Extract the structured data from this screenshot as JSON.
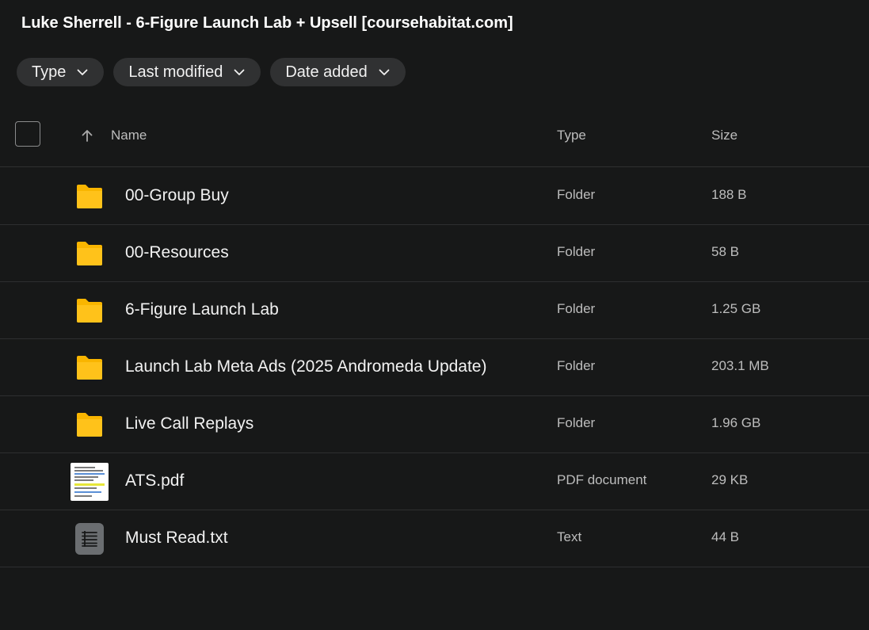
{
  "header": {
    "title": "Luke Sherrell - 6-Figure Launch Lab + Upsell [coursehabitat.com]"
  },
  "filters": {
    "type_label": "Type",
    "last_modified_label": "Last modified",
    "date_added_label": "Date added"
  },
  "table": {
    "columns": {
      "name": "Name",
      "type": "Type",
      "size": "Size"
    },
    "sort_icon": "arrow-up-icon",
    "rows": [
      {
        "icon": "folder-icon",
        "name": "00-Group Buy",
        "type": "Folder",
        "size": "188 B"
      },
      {
        "icon": "folder-icon",
        "name": "00-Resources",
        "type": "Folder",
        "size": "58 B"
      },
      {
        "icon": "folder-icon",
        "name": "6-Figure Launch Lab",
        "type": "Folder",
        "size": "1.25 GB"
      },
      {
        "icon": "folder-icon",
        "name": "Launch Lab Meta Ads (2025 Andromeda Update)",
        "type": "Folder",
        "size": "203.1 MB"
      },
      {
        "icon": "folder-icon",
        "name": "Live Call Replays",
        "type": "Folder",
        "size": "1.96 GB"
      },
      {
        "icon": "pdf-thumbnail-icon",
        "name": "ATS.pdf",
        "type": "PDF document",
        "size": "29 KB"
      },
      {
        "icon": "text-file-icon",
        "name": "Must Read.txt",
        "type": "Text",
        "size": "44 B"
      }
    ]
  },
  "colors": {
    "background": "#171818",
    "chip": "#303132",
    "folder": "#f9b500",
    "divider": "#2e2f30"
  }
}
